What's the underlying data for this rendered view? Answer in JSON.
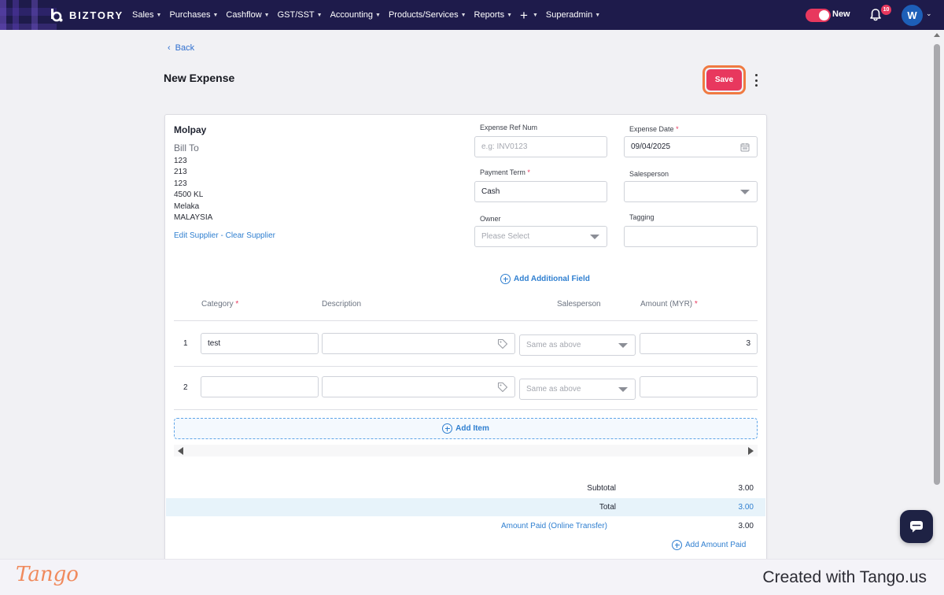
{
  "app": {
    "brand": "BIZTORY",
    "nav": [
      "Sales",
      "Purchases",
      "Cashflow",
      "GST/SST",
      "Accounting",
      "Products/Services",
      "Reports",
      "+",
      "Superadmin"
    ],
    "toggle_label": "New",
    "notification_count": "10",
    "avatar_initial": "W"
  },
  "page": {
    "back_label": "Back",
    "title": "New Expense",
    "save_label": "Save"
  },
  "supplier": {
    "name": "Molpay",
    "bill_to_label": "Bill To",
    "address_lines": [
      "123",
      "213",
      "123",
      "4500 KL",
      "Melaka",
      "MALAYSIA"
    ],
    "edit_link": "Edit Supplier",
    "separator": " - ",
    "clear_link": "Clear Supplier"
  },
  "form": {
    "ref_num": {
      "label": "Expense Ref Num",
      "placeholder": "e.g: INV0123",
      "value": ""
    },
    "date": {
      "label": "Expense Date",
      "value": "09/04/2025"
    },
    "payment_term": {
      "label": "Payment Term",
      "value": "Cash"
    },
    "salesperson": {
      "label": "Salesperson",
      "value": ""
    },
    "owner": {
      "label": "Owner",
      "placeholder": "Please Select"
    },
    "tagging": {
      "label": "Tagging",
      "value": ""
    },
    "add_field_label": "Add Additional Field"
  },
  "items_table": {
    "headers": {
      "category": "Category",
      "description": "Description",
      "salesperson": "Salesperson",
      "amount": "Amount (MYR)"
    },
    "rows": [
      {
        "num": "1",
        "category": "test",
        "description": "",
        "salesperson_placeholder": "Same as above",
        "amount": "3"
      },
      {
        "num": "2",
        "category": "",
        "description": "",
        "salesperson_placeholder": "Same as above",
        "amount": ""
      }
    ],
    "add_item_label": "Add Item"
  },
  "summary": {
    "subtotal_label": "Subtotal",
    "subtotal_value": "3.00",
    "total_label": "Total",
    "total_value": "3.00",
    "paid_label": "Amount Paid (Online Transfer)",
    "paid_value": "3.00",
    "add_paid_label": "Add Amount Paid"
  },
  "footer": {
    "logo": "Tango",
    "text": "Created with Tango.us"
  },
  "colors": {
    "nav_bg": "#1e1b4b",
    "accent": "#e8385e",
    "link": "#2f7fd0",
    "highlight_ring": "#f07a41"
  }
}
